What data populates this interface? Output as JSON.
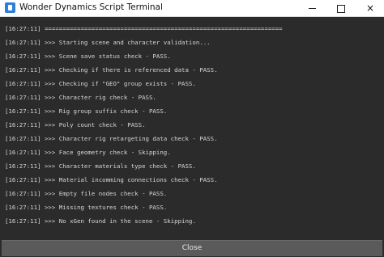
{
  "window": {
    "title": "Wonder Dynamics Script Terminal",
    "icon": "app-icon",
    "controls": {
      "minimize": "minimize-icon",
      "maximize": "maximize-icon",
      "close": "×"
    }
  },
  "terminal": {
    "lines": [
      "[16:27:11] ==================================================================",
      "[16:27:11] >>> Starting scene and character validation...",
      "[16:27:11] >>> Scene save status check - PASS.",
      "[16:27:11] >>> Checking if there is referenced data - PASS.",
      "[16:27:11] >>> Checking if \"GEO\" group exists - PASS.",
      "[16:27:11] >>> Character rig check - PASS.",
      "[16:27:11] >>> Rig group suffix check - PASS.",
      "[16:27:11] >>> Poly count check - PASS.",
      "[16:27:11] >>> Character rig retargeting data check - PASS.",
      "[16:27:11] >>> Face geometry check - Skipping.",
      "[16:27:11] >>> Character materials type check - PASS.",
      "[16:27:11] >>> Material incomming connections check - PASS.",
      "[16:27:11] >>> Empty file nodes check - PASS.",
      "[16:27:11] >>> Missing textures check - PASS.",
      "[16:27:11] >>> No xGen found in the scene - Skipping."
    ]
  },
  "footer": {
    "close_label": "Close"
  },
  "colors": {
    "background": "#2b2b2b",
    "text": "#d6d6d6",
    "button": "#5a5a5a"
  }
}
